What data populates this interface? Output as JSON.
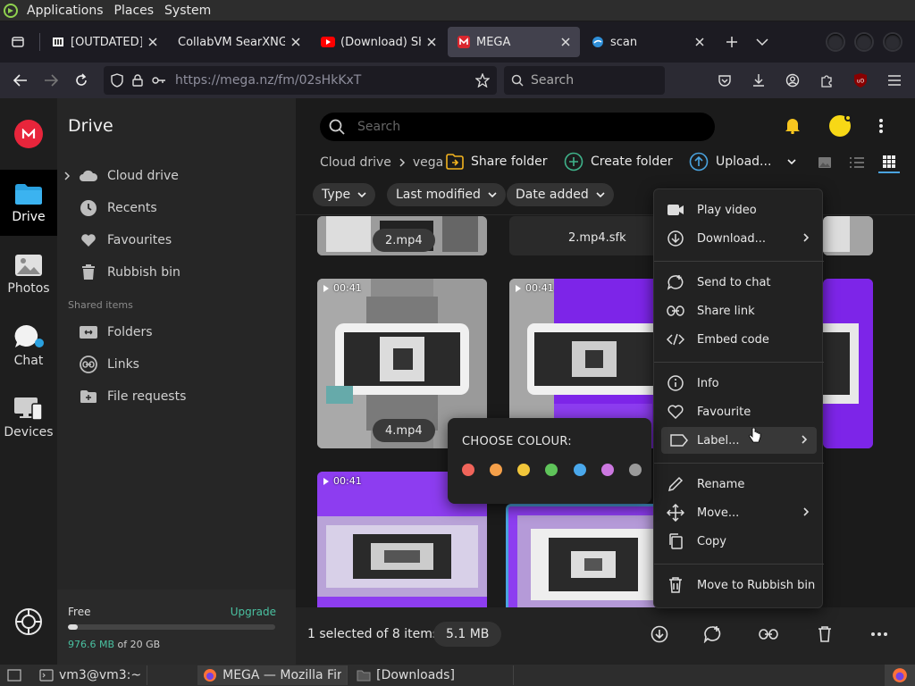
{
  "os": {
    "menus": [
      "Applications",
      "Places",
      "System"
    ]
  },
  "browser": {
    "tabs": [
      {
        "title": "[OUTDATED] All",
        "icon": "archive-icon",
        "active": false
      },
      {
        "title": "CollabVM SearXNG",
        "icon": "none",
        "active": false
      },
      {
        "title": "(Download) Shu",
        "icon": "youtube-icon",
        "active": false
      },
      {
        "title": "MEGA",
        "icon": "mega-icon",
        "active": true
      },
      {
        "title": "scan",
        "icon": "scan-icon",
        "active": false
      }
    ],
    "url": "https://mega.nz/fm/02sHkKxT",
    "search_placeholder": "Search"
  },
  "mega": {
    "rail": [
      {
        "label": "Drive",
        "icon": "drive-folder-icon",
        "active": true
      },
      {
        "label": "Photos",
        "icon": "photos-icon",
        "active": false
      },
      {
        "label": "Chat",
        "icon": "chat-icon",
        "active": false
      },
      {
        "label": "Devices",
        "icon": "devices-icon",
        "active": false
      }
    ],
    "sidebar": {
      "title": "Drive",
      "items": [
        {
          "label": "Cloud drive",
          "icon": "cloud-icon"
        },
        {
          "label": "Recents",
          "icon": "clock-icon"
        },
        {
          "label": "Favourites",
          "icon": "heart-icon"
        },
        {
          "label": "Rubbish bin",
          "icon": "trash-icon"
        }
      ],
      "shared_title": "Shared items",
      "shared": [
        {
          "label": "Folders",
          "icon": "shared-folder-icon"
        },
        {
          "label": "Links",
          "icon": "link-icon"
        },
        {
          "label": "File requests",
          "icon": "file-request-icon"
        }
      ],
      "storage": {
        "free_label": "Free",
        "upgrade_label": "Upgrade",
        "used": "976.6 MB",
        "of_total": " of 20 GB",
        "used_fraction": 0.048
      }
    },
    "main": {
      "search_placeholder": "Search",
      "breadcrumb": [
        "Cloud drive",
        "vega"
      ],
      "actions": {
        "share": "Share folder",
        "create": "Create folder",
        "upload": "Upload..."
      },
      "filters": [
        "Type",
        "Last modified",
        "Date added"
      ],
      "files": {
        "row1": [
          "2.mp4",
          "2.mp4.sfk"
        ],
        "row2_name": "4.mp4",
        "duration": "00:41"
      },
      "status": {
        "selected": "1 selected of 8 items",
        "size": "5.1 MB"
      }
    },
    "context_menu": {
      "play": "Play video",
      "download": "Download...",
      "send": "Send to chat",
      "share_link": "Share link",
      "embed": "Embed code",
      "info": "Info",
      "favourite": "Favourite",
      "label": "Label...",
      "rename": "Rename",
      "move": "Move...",
      "copy": "Copy",
      "rubbish": "Move to Rubbish bin"
    },
    "colour_picker": {
      "heading": "CHOOSE COLOUR:",
      "swatches": [
        "#f0645a",
        "#f5a04a",
        "#f1c63a",
        "#5fc45a",
        "#4aa8ec",
        "#cc78e0",
        "#9a9a9a"
      ]
    }
  },
  "taskbar": {
    "items": [
      {
        "label": "vm3@vm3:~",
        "icon": "terminal-icon",
        "active": false
      },
      {
        "label": "MEGA — Mozilla Fir...",
        "icon": "firefox-icon",
        "active": true
      },
      {
        "label": "[Downloads]",
        "icon": "folder-icon",
        "active": false
      }
    ]
  }
}
